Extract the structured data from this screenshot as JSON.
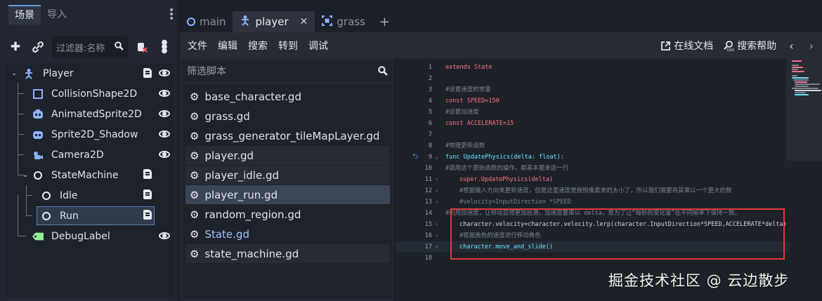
{
  "scene_dock": {
    "tabs": [
      "场景",
      "导入"
    ],
    "filter_placeholder": "过滤器:名称",
    "nodes": [
      {
        "name": "Player",
        "icon": "player-node-icon"
      },
      {
        "name": "CollisionShape2D",
        "icon": "collision-shape-icon"
      },
      {
        "name": "AnimatedSprite2D",
        "icon": "animated-sprite-icon"
      },
      {
        "name": "Sprite2D_Shadow",
        "icon": "sprite-icon"
      },
      {
        "name": "Camera2D",
        "icon": "camera-icon"
      },
      {
        "name": "StateMachine",
        "icon": "node-icon"
      },
      {
        "name": "Idle",
        "icon": "node-icon"
      },
      {
        "name": "Run",
        "icon": "node-icon"
      },
      {
        "name": "DebugLabel",
        "icon": "label-icon"
      }
    ],
    "selected_node": "Run"
  },
  "editor_tabs": [
    {
      "label": "main",
      "icon": "node-icon"
    },
    {
      "label": "player",
      "icon": "player-node-icon"
    },
    {
      "label": "grass",
      "icon": "frame-icon"
    }
  ],
  "menu": {
    "items": [
      "文件",
      "编辑",
      "搜索",
      "转到",
      "调试"
    ],
    "online_docs": "在线文档",
    "search_help": "搜索帮助"
  },
  "script_panel": {
    "filter_placeholder": "筛选脚本",
    "scripts": [
      "base_character.gd",
      "grass.gd",
      "grass_generator_tileMapLayer.gd",
      "player.gd",
      "player_idle.gd",
      "player_run.gd",
      "random_region.gd",
      "State.gd",
      "state_machine.gd"
    ],
    "selected": "player_run.gd"
  },
  "code": {
    "lines": [
      {
        "n": "1",
        "text": "extends State"
      },
      {
        "n": "2",
        "text": ""
      },
      {
        "n": "3",
        "text": "#设置速度的常量"
      },
      {
        "n": "4",
        "text": "const SPEED=150"
      },
      {
        "n": "5",
        "text": "#设置加速度"
      },
      {
        "n": "6",
        "text": "const ACCELERATE=15"
      },
      {
        "n": "7",
        "text": ""
      },
      {
        "n": "8",
        "text": "#物理更新函数"
      },
      {
        "n": "9",
        "text": "func UpdatePhysics(delta: float):"
      },
      {
        "n": "10",
        "text": "#调用这个原始函数的操作，都基本要来这一行"
      },
      {
        "n": "11",
        "text": "super.UpdatePhysics(delta)"
      },
      {
        "n": "12",
        "text": "#根据输入方向来更新速度，但是这里速度是按照像素来的太小了，所以我们需要将其乘以一个更大的数"
      },
      {
        "n": "13",
        "text": "#velocity=InputDirection *SPEED"
      },
      {
        "n": "14",
        "text": "#利用加速度，让移动显得更加丝滑，加速度要乘以 delta，是为了让“每秒的变化量”在不同帧率下保持一致。"
      },
      {
        "n": "15",
        "text": "character.velocity=character.velocity.lerp(character.InputDirection*SPEED,ACCELERATE*delta)"
      },
      {
        "n": "16",
        "text": "#根据角色的速度进行移动角色"
      },
      {
        "n": "17",
        "text": "character.move_and_slide()"
      },
      {
        "n": "18",
        "text": ""
      }
    ]
  },
  "watermark": "掘金技术社区 @ 云边散步",
  "colors": {
    "accent": "#699ce8",
    "highlight_box": "#e0393b",
    "keyword": "#ff7085",
    "function": "#66e6ff",
    "comment": "#7b8491"
  }
}
